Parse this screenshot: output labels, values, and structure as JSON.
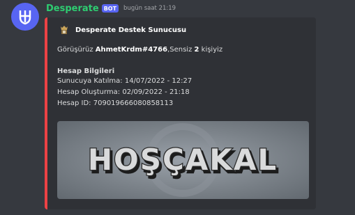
{
  "message": {
    "username": "Desperate",
    "bot_badge": "BOT",
    "timestamp": "bugün saat 21:19",
    "accent_color": "#2ecc71"
  },
  "embed": {
    "border_color": "#ed4245",
    "author": {
      "name": "Desperate Destek Sunucusu",
      "icon": "crest-emblem-icon"
    },
    "description": {
      "prefix": "Görüşürüz ",
      "user": "AhmetKrdm#4766",
      "middle": ",Sensiz ",
      "count": "2",
      "suffix": " kişiyiz"
    },
    "field": {
      "title": "Hesap Bilgileri",
      "lines": [
        "Sunucuya Katılma: 14/07/2022 - 12:27",
        "Hesap Oluşturma: 02/09/2022 - 21:18",
        "Hesap ID: 709019666080858113"
      ]
    },
    "image": {
      "text": "HOŞÇAKAL"
    }
  }
}
